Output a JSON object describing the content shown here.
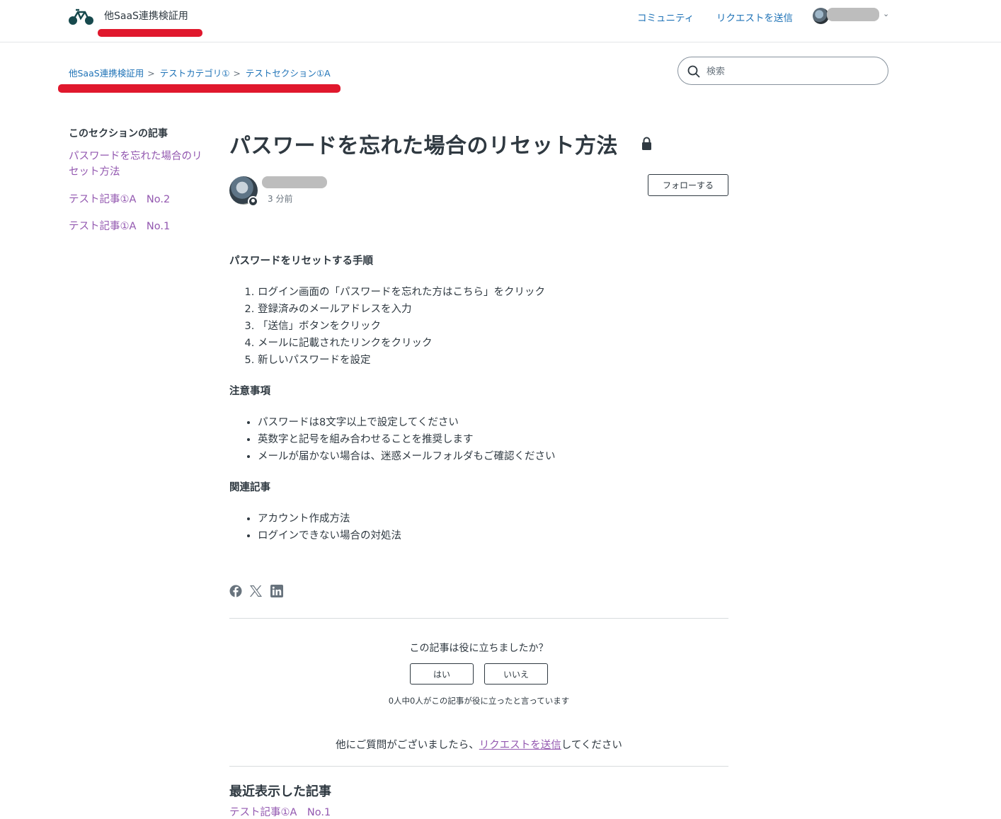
{
  "header": {
    "brand": "他SaaS連携検証用",
    "nav": {
      "community": "コミュニティ",
      "request": "リクエストを送信"
    }
  },
  "breadcrumb": [
    "他SaaS連携検証用",
    "テストカテゴリ①",
    "テストセクション①A"
  ],
  "search": {
    "placeholder": "検索"
  },
  "sidebar": {
    "title": "このセクションの記事",
    "items": [
      "パスワードを忘れた場合のリセット方法",
      "テスト記事①A　No.2",
      "テスト記事①A　No.1"
    ]
  },
  "article": {
    "title": "パスワードを忘れた場合のリセット方法",
    "time": "3 分前",
    "follow_label": "フォローする",
    "section1": {
      "heading": "パスワードをリセットする手順",
      "steps": [
        "ログイン画面の「パスワードを忘れた方はこちら」をクリック",
        "登録済みのメールアドレスを入力",
        "「送信」ボタンをクリック",
        "メールに記載されたリンクをクリック",
        "新しいパスワードを設定"
      ]
    },
    "section2": {
      "heading": "注意事項",
      "items": [
        "パスワードは8文字以上で設定してください",
        "英数字と記号を組み合わせることを推奨します",
        "メールが届かない場合は、迷惑メールフォルダもご確認ください"
      ]
    },
    "section3": {
      "heading": "関連記事",
      "items": [
        "アカウント作成方法",
        "ログインできない場合の対処法"
      ]
    }
  },
  "vote": {
    "question": "この記事は役に立ちましたか？",
    "yes": "はい",
    "no": "いいえ",
    "count": "0人中0人がこの記事が役に立ったと言っています"
  },
  "more_questions": {
    "before": "他にご質問がございましたら、",
    "link": "リクエストを送信",
    "after": "してください"
  },
  "recently_viewed": {
    "title": "最近表示した記事",
    "items": [
      "テスト記事①A　No.1"
    ]
  },
  "colors": {
    "link_blue": "#1f73b7",
    "visited_purple": "#9358b0",
    "annotation_red": "#e0182d"
  },
  "icons": [
    "logo-bike-icon",
    "search-icon",
    "lock-icon",
    "facebook-icon",
    "x-icon",
    "linkedin-icon",
    "chevron-down-icon"
  ]
}
